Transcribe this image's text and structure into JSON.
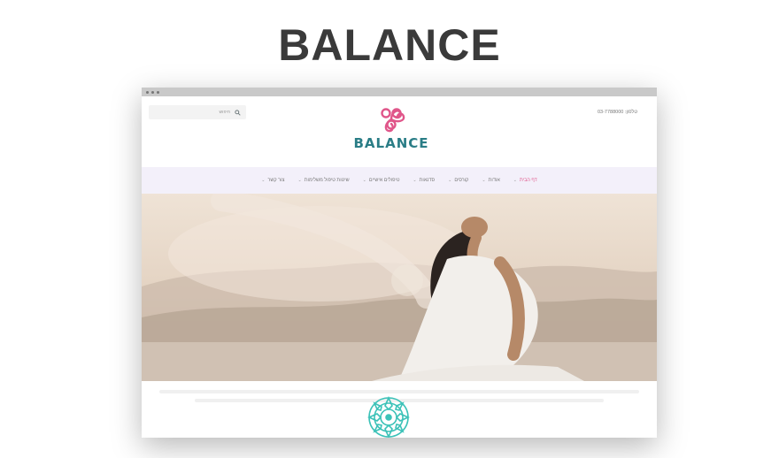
{
  "page": {
    "heading": "BALANCE"
  },
  "site": {
    "logo_text": "BALANCE",
    "search_placeholder": "חיפוש",
    "phone_text": "03-7788000 :טלפון",
    "nav": [
      {
        "label": "דף הבית",
        "active": true
      },
      {
        "label": "אודות"
      },
      {
        "label": "קורסים"
      },
      {
        "label": "סדנאות"
      },
      {
        "label": "טיפולים אישיים"
      },
      {
        "label": "שיטות טיפול משלימות"
      },
      {
        "label": "צור קשר"
      }
    ]
  },
  "colors": {
    "accent_pink": "#e0568a",
    "logo_teal": "#2a7d86",
    "mandala_teal": "#3cc2b8",
    "nav_bg": "#f3f0fa"
  },
  "icons": {
    "search": "search-icon",
    "logo": "triskele-icon",
    "section": "mandala-icon"
  }
}
